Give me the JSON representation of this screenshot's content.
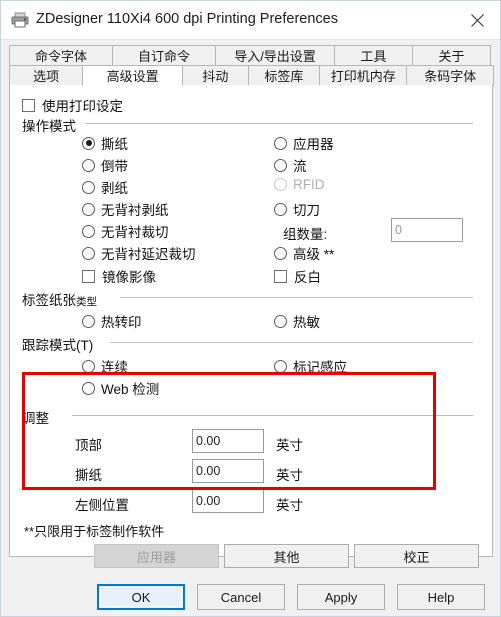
{
  "window": {
    "title": "ZDesigner 110Xi4 600 dpi Printing Preferences",
    "printer_icon": "printer-icon",
    "close_icon": "close-icon",
    "accent_color": "#0078D7",
    "annotation_color": "#E60000"
  },
  "tabs": {
    "row1": [
      {
        "label": "命令字体",
        "active": false
      },
      {
        "label": "自订命令",
        "active": false
      },
      {
        "label": "导入/导出设置",
        "active": false
      },
      {
        "label": "工具",
        "active": false
      },
      {
        "label": "关于",
        "active": false
      }
    ],
    "row2": [
      {
        "label": "选项",
        "active": false
      },
      {
        "label": "高级设置",
        "active": true
      },
      {
        "label": "抖动",
        "active": false
      },
      {
        "label": "标签库",
        "active": false
      },
      {
        "label": "打印机内存",
        "active": false
      },
      {
        "label": "条码字体",
        "active": false
      }
    ]
  },
  "use_printer_settings": {
    "label": "使用打印设定",
    "checked": false
  },
  "operation_mode": {
    "title": "操作模式",
    "left_options": [
      {
        "label": "撕纸",
        "checked": true,
        "disabled": false
      },
      {
        "label": "倒带",
        "checked": false,
        "disabled": false
      },
      {
        "label": "剥纸",
        "checked": false,
        "disabled": false
      },
      {
        "label": "无背衬剥纸",
        "checked": false,
        "disabled": false
      },
      {
        "label": "无背衬裁切",
        "checked": false,
        "disabled": false
      },
      {
        "label": "无背衬延迟裁切",
        "checked": false,
        "disabled": false
      }
    ],
    "right_options": [
      {
        "label": "应用器",
        "checked": false,
        "disabled": false
      },
      {
        "label": "流",
        "checked": false,
        "disabled": false
      },
      {
        "label": "RFID",
        "checked": false,
        "disabled": true
      },
      {
        "label": "切刀",
        "checked": false,
        "disabled": false
      },
      {
        "label": "高级 **",
        "checked": false,
        "disabled": false
      }
    ],
    "group_count": {
      "label": "组数量:",
      "value": "0"
    },
    "mirror_image": {
      "label": "镜像影像",
      "checked": false
    },
    "invert": {
      "label": "反白",
      "checked": false
    }
  },
  "media_type": {
    "title_main": "标签纸张",
    "title_sub": "类型",
    "options": [
      {
        "label": "热转印",
        "checked": false
      },
      {
        "label": "热敏",
        "checked": false
      }
    ]
  },
  "tracking_mode": {
    "title": "跟踪模式(T)",
    "options": [
      {
        "label": "连续",
        "checked": false
      },
      {
        "label": "标记感应",
        "checked": false
      },
      {
        "label": "Web 检测",
        "checked": false
      }
    ]
  },
  "adjustment": {
    "title": "调整",
    "rows": [
      {
        "label": "顶部",
        "value": "0.00",
        "unit": "英寸"
      },
      {
        "label": "撕纸",
        "value": "0.00",
        "unit": "英寸"
      },
      {
        "label": "左侧位置",
        "value": "0.00",
        "unit": "英寸"
      }
    ]
  },
  "footnote": "**只限用于标签制作软件",
  "panel_buttons": [
    {
      "label": "应用器",
      "disabled": true
    },
    {
      "label": "其他",
      "disabled": false
    },
    {
      "label": "校正",
      "disabled": false
    }
  ],
  "dialog_buttons": [
    {
      "label": "OK",
      "default": true
    },
    {
      "label": "Cancel",
      "default": false
    },
    {
      "label": "Apply",
      "default": false
    },
    {
      "label": "Help",
      "default": false
    }
  ]
}
